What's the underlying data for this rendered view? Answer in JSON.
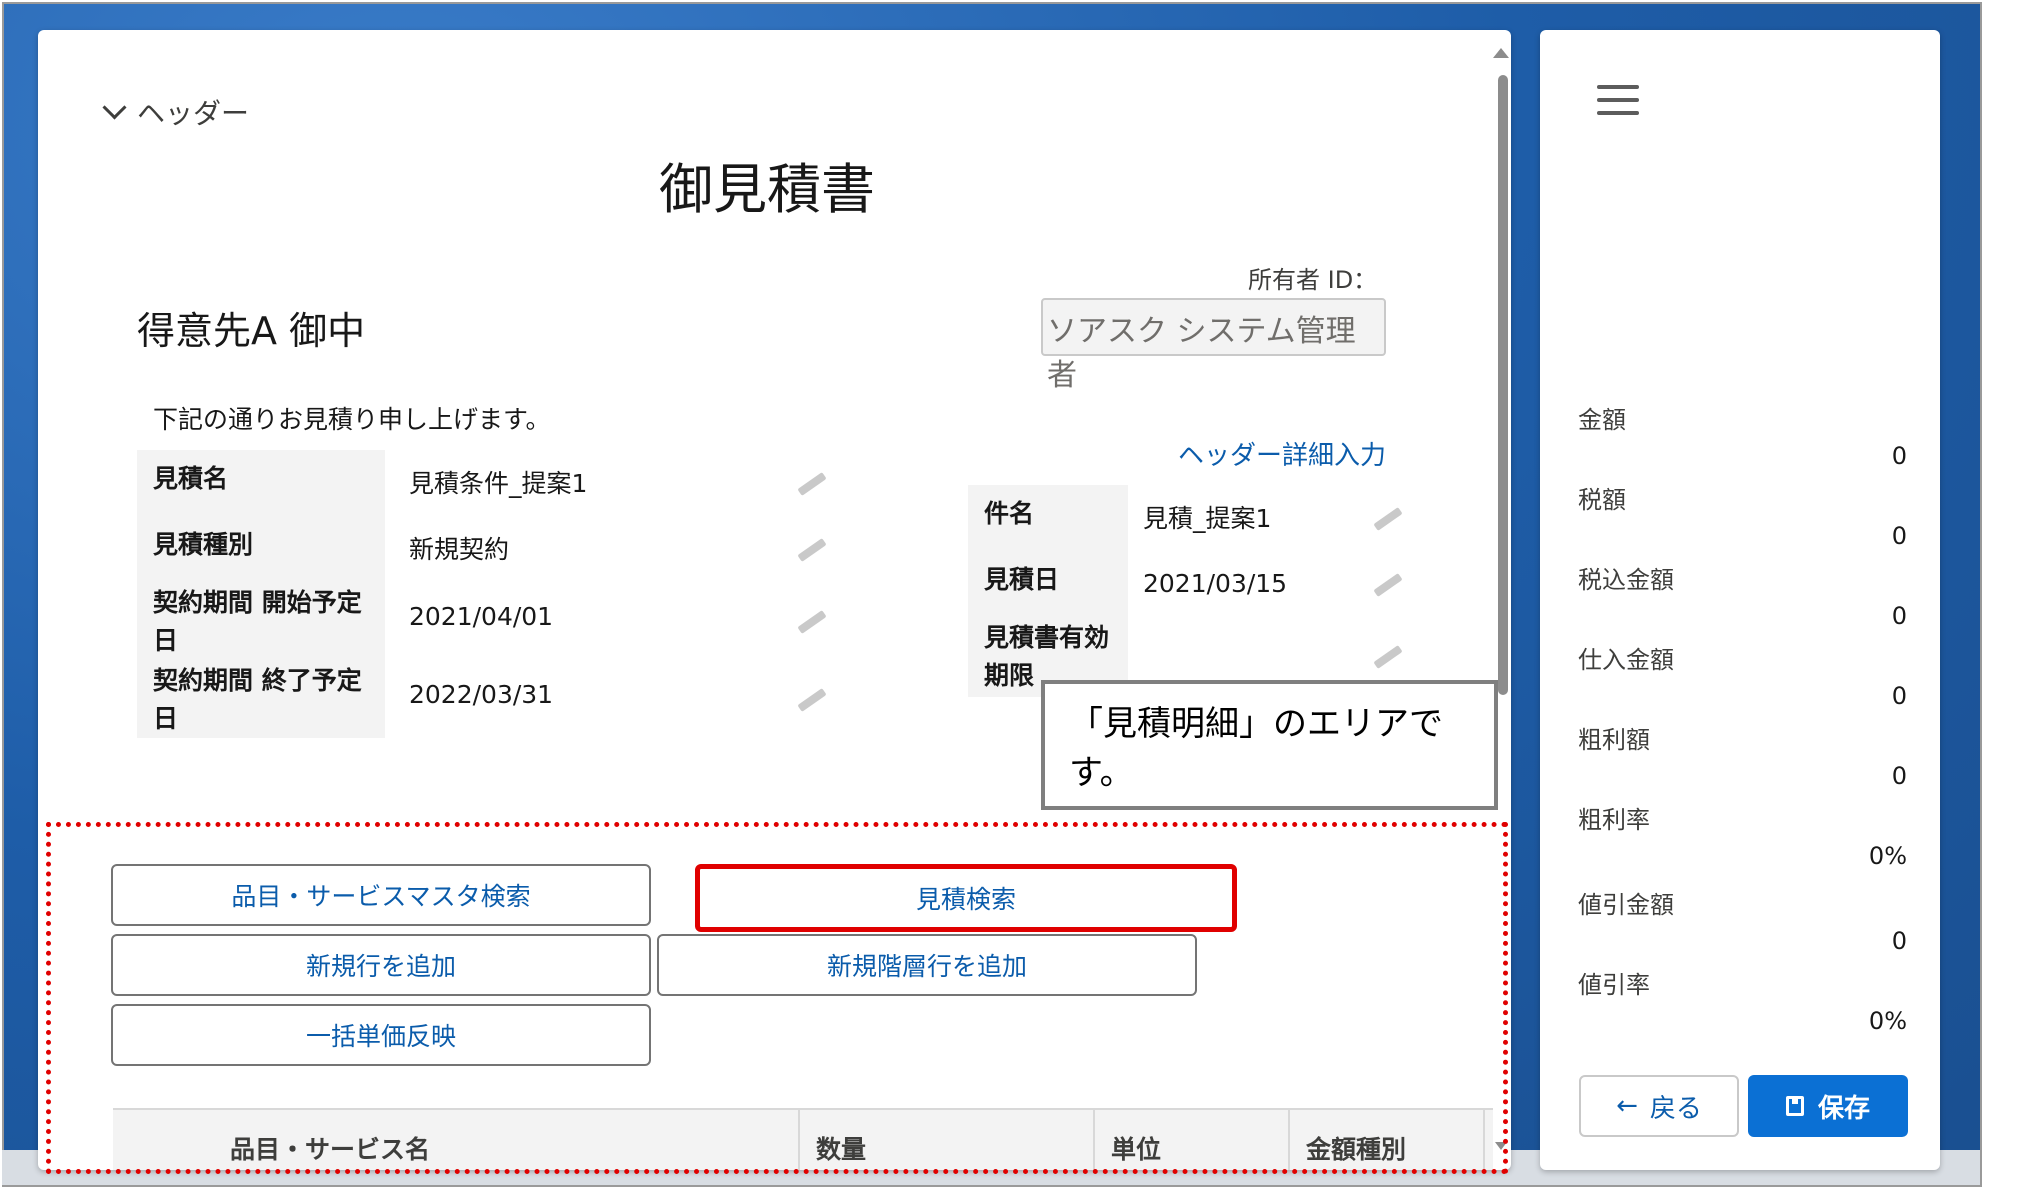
{
  "header_section": {
    "toggle_label": "ヘッダー"
  },
  "document": {
    "title": "御見積書",
    "customer": "得意先A 御中",
    "intro": "下記の通りお見積り申し上げます。"
  },
  "owner": {
    "label": "所有者 ID：",
    "value": "ソアスク システム管理者"
  },
  "header_detail_link": "ヘッダー詳細入力",
  "left_fields": [
    {
      "label": "見積名",
      "value": "見積条件_提案1"
    },
    {
      "label": "見積種別",
      "value": "新規契約"
    },
    {
      "label_line1": "契約期間 開始予定",
      "label_line2": "日",
      "value": "2021/04/01"
    },
    {
      "label_line1": "契約期間 終了予定",
      "label_line2": "日",
      "value": "2022/03/31"
    }
  ],
  "right_fields": [
    {
      "label": "件名",
      "value": "見積_提案1"
    },
    {
      "label": "見積日",
      "value": "2021/03/15"
    },
    {
      "label_line1": "見積書有効",
      "label_line2": "期限",
      "value": ""
    }
  ],
  "callout": "「見積明細」のエリアです。",
  "buttons": {
    "item_master_search": "品目・サービスマスタ検索",
    "quote_search": "見積検索",
    "add_new_row": "新規行を追加",
    "add_new_hierarchy_row": "新規階層行を追加",
    "bulk_unit_price": "一括単価反映"
  },
  "grid": {
    "columns": [
      "品目・サービス名",
      "数量",
      "単位",
      "金額種別"
    ]
  },
  "summary": [
    {
      "label": "金額",
      "value": "0"
    },
    {
      "label": "税額",
      "value": "0"
    },
    {
      "label": "税込金額",
      "value": "0"
    },
    {
      "label": "仕入金額",
      "value": "0"
    },
    {
      "label": "粗利額",
      "value": "0"
    },
    {
      "label": "粗利率",
      "value": "0%"
    },
    {
      "label": "値引金額",
      "value": "0"
    },
    {
      "label": "値引率",
      "value": "0%"
    }
  ],
  "actions": {
    "back": "戻る",
    "save": "保存"
  },
  "colors": {
    "accent": "#0b70d4",
    "link": "#0b5cab",
    "highlight": "#e00000"
  },
  "icons": [
    "chevron-down-icon",
    "pencil-icon",
    "menu-icon",
    "arrow-left-icon",
    "save-icon"
  ]
}
